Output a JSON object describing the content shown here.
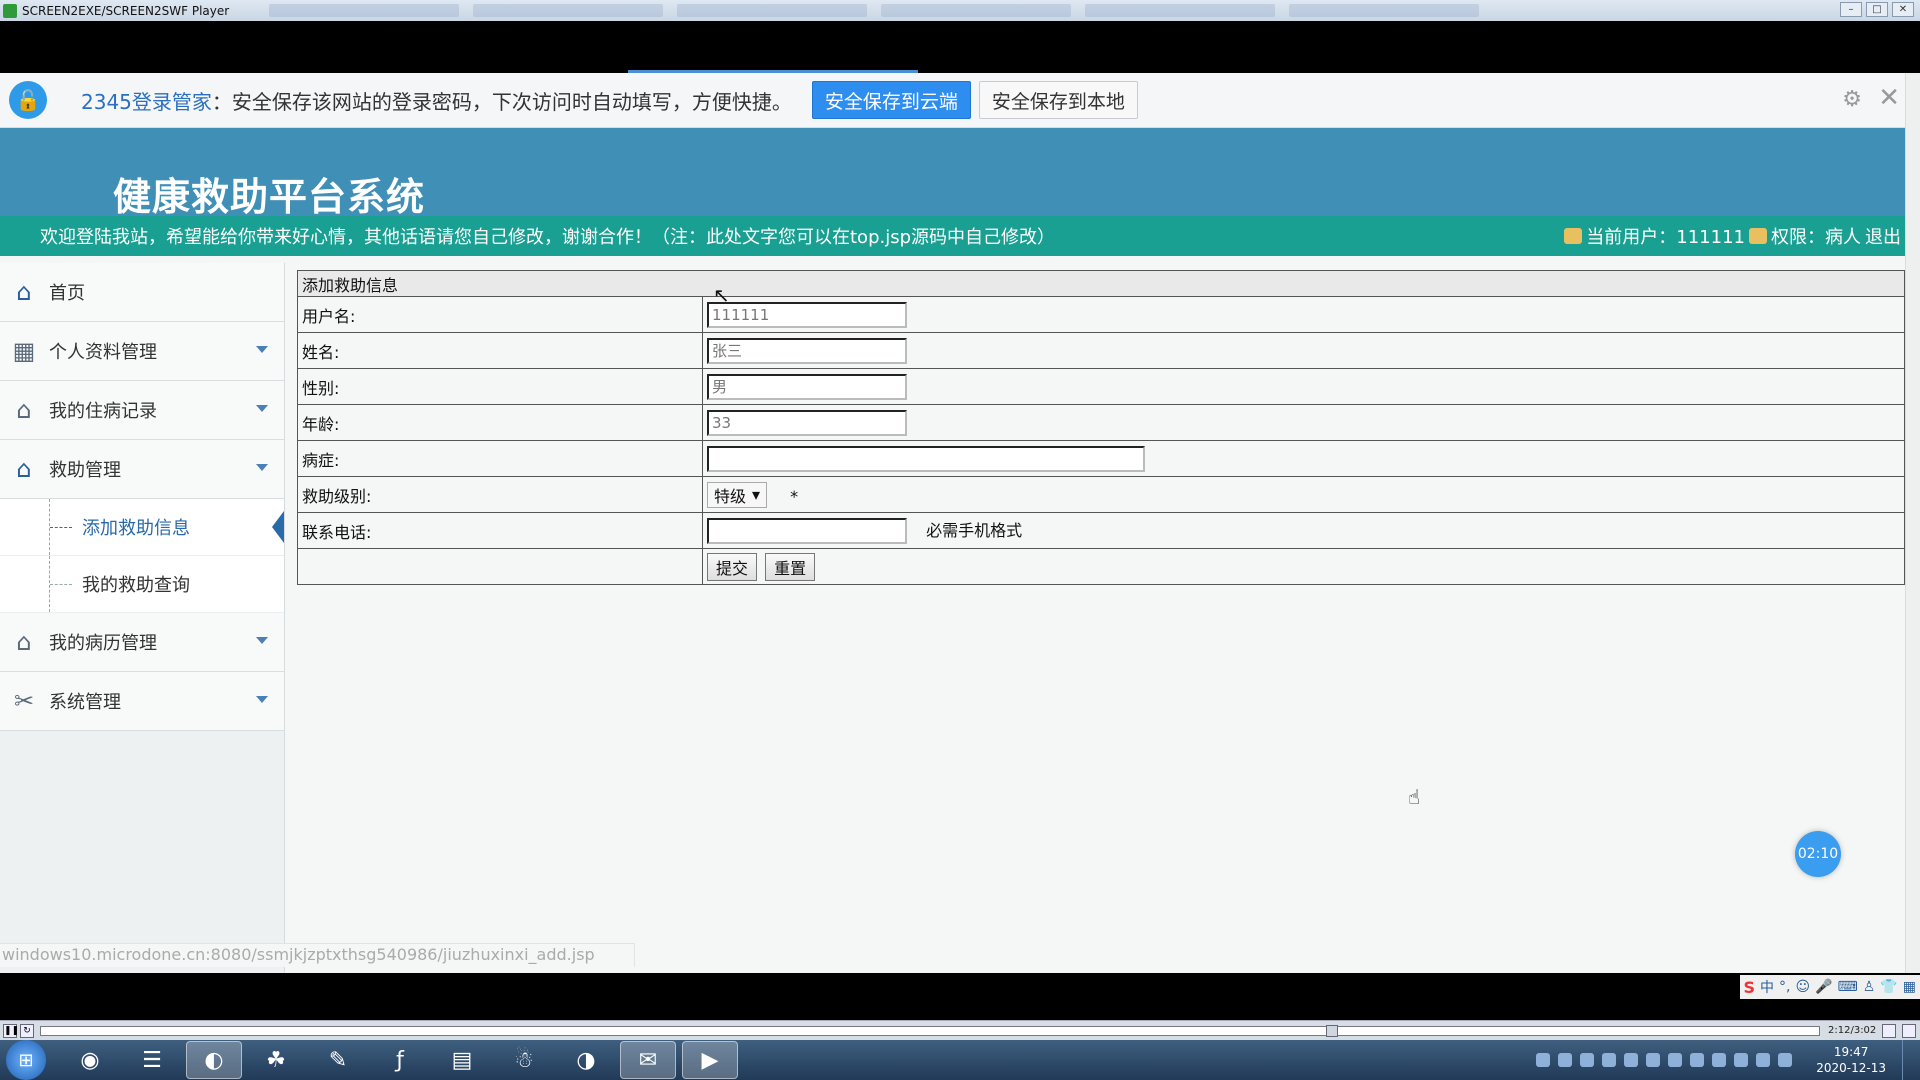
{
  "player": {
    "title": "SCREEN2EXE/SCREEN2SWF Player",
    "time": "2:12/3:02"
  },
  "pw_manager": {
    "brand": "2345登录管家",
    "message": "：安全保存该网站的登录密码，下次访问时自动填写，方便快捷。",
    "save_cloud": "安全保存到云端",
    "save_local": "安全保存到本地"
  },
  "site": {
    "title": "健康救助平台系统",
    "welcome": "欢迎登陆我站，希望能给你带来好心情，其他话语请您自己修改，谢谢合作！（注：此处文字您可以在top.jsp源码中自己修改）",
    "current_user": "当前用户：111111",
    "role": "权限：病人",
    "logout": "退出"
  },
  "sidebar": {
    "items": [
      {
        "label": "首页"
      },
      {
        "label": "个人资料管理"
      },
      {
        "label": "我的住病记录"
      },
      {
        "label": "救助管理"
      },
      {
        "label": "我的病历管理"
      },
      {
        "label": "系统管理"
      }
    ],
    "sub_items": [
      {
        "label": "添加救助信息"
      },
      {
        "label": "我的救助查询"
      }
    ]
  },
  "form": {
    "header": "添加救助信息",
    "username_label": "用户名:",
    "username_value": "111111",
    "name_label": "姓名:",
    "name_value": "张三",
    "gender_label": "性别:",
    "gender_value": "男",
    "age_label": "年龄:",
    "age_value": "33",
    "disease_label": "病症:",
    "disease_value": "",
    "level_label": "救助级别:",
    "level_value": "特级",
    "required_mark": "*",
    "phone_label": "联系电话:",
    "phone_value": "",
    "phone_hint": "必需手机格式",
    "submit": "提交",
    "reset": "重置"
  },
  "status_url": "windows10.microdone.cn:8080/ssmjkjzptxthsg540986/jiuzhuxinxi_add.jsp",
  "timer": "02:10",
  "taskbar": {
    "time": "19:47",
    "date": "2020-12-13"
  },
  "ime": {
    "lang": "中"
  }
}
